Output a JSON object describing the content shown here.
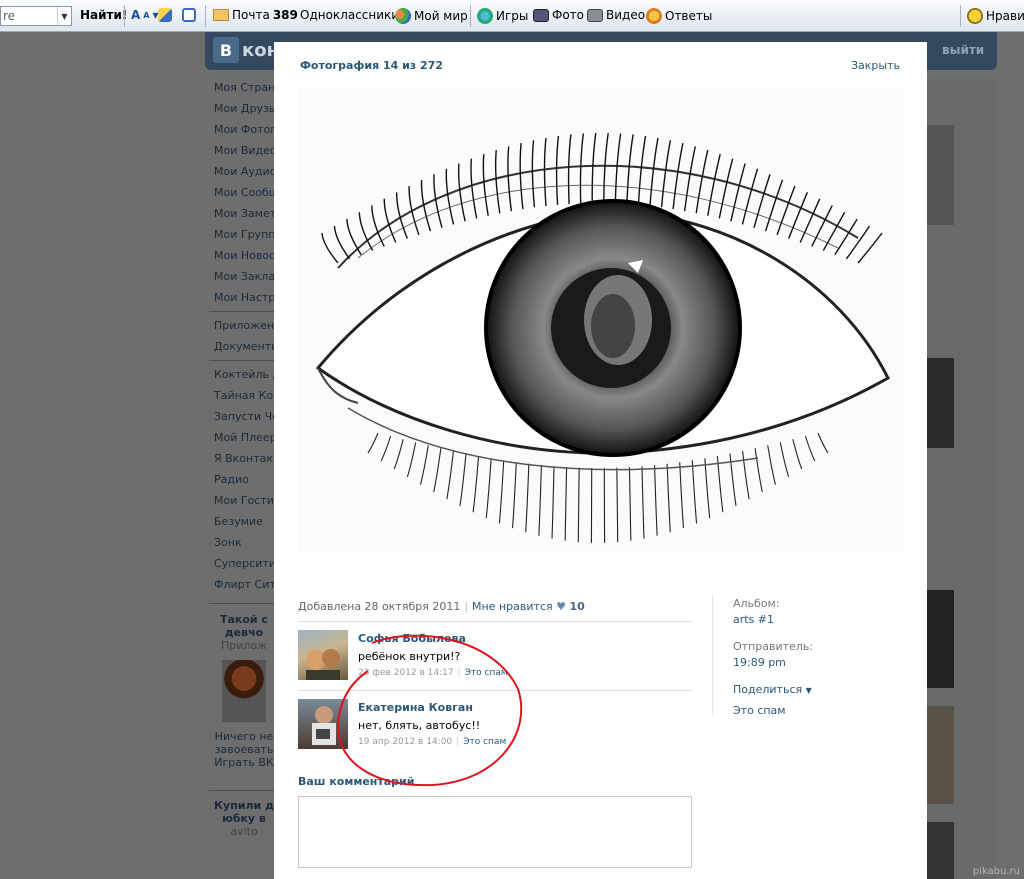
{
  "toolbar": {
    "search_value": "re",
    "find_label": "Найти!",
    "mail_label": "Почта",
    "mail_count": "389",
    "odnoklassniki_label": "Одноклассники",
    "moimir_label": "Мой мир",
    "games_label": "Игры",
    "photo_label": "Фото",
    "video_label": "Видео",
    "answers_label": "Ответы",
    "like_label": "Нрави"
  },
  "background": {
    "logo_letter": "В",
    "logo_text": "кон",
    "exit_label": "выйти",
    "left_menu": [
      "Моя Страни",
      "Мои Друзья",
      "Мои Фотогр",
      "Мои Видеоз",
      "Мои Аудиоз",
      "Мои Сообщ",
      "Мои Заметк",
      "Мои Группы",
      "Мои Новост",
      "Мои Заклад",
      "Мои Настро"
    ],
    "left_menu2": [
      "Приложени",
      "Документы"
    ],
    "left_menu3": [
      "Коктейль Д",
      "Тайная Ком",
      "Запусти Че",
      "Мой Плеер",
      "Я Вконтакт",
      "Радио",
      "Мои Гости",
      "Безумие",
      "Зонк",
      "Суперсити",
      "Флирт Сити"
    ],
    "ad1_title": [
      "Такой с",
      "девчо"
    ],
    "ad1_sub": "Прилож",
    "ad1_text": [
      "Ничего не",
      "завоевать",
      "Играть ВК"
    ],
    "ad2_title": [
      "Купили д",
      "юбку в"
    ],
    "ad2_sub": "avito",
    "watermark": "pikabu.ru"
  },
  "modal": {
    "title": "Фотография 14 из 272",
    "close_label": "Закрыть",
    "added": "Добавлена 28 октября 2011",
    "like_link": "Мне нравится",
    "like_count": "10",
    "comments": [
      {
        "author": "Софья Бобылева",
        "text": "ребёнок внутри!?",
        "date": "23 фев 2012 в 14:17",
        "spam": "Это спам"
      },
      {
        "author": "Екатерина Ковган",
        "text": "нет, блять, автобус!!",
        "date": "19 апр 2012 в 14:00",
        "spam": "Это спам"
      }
    ],
    "comment_label": "Ваш комментарий",
    "side": {
      "album_label": "Альбом:",
      "album_value": "arts #1",
      "sender_label": "Отправитель:",
      "sender_value": "19:89 pm",
      "share_label": "Поделиться",
      "spam_label": "Это спам"
    }
  },
  "colors": {
    "link": "#2b587a",
    "header": "#34495f",
    "annotation": "#e0141e"
  }
}
